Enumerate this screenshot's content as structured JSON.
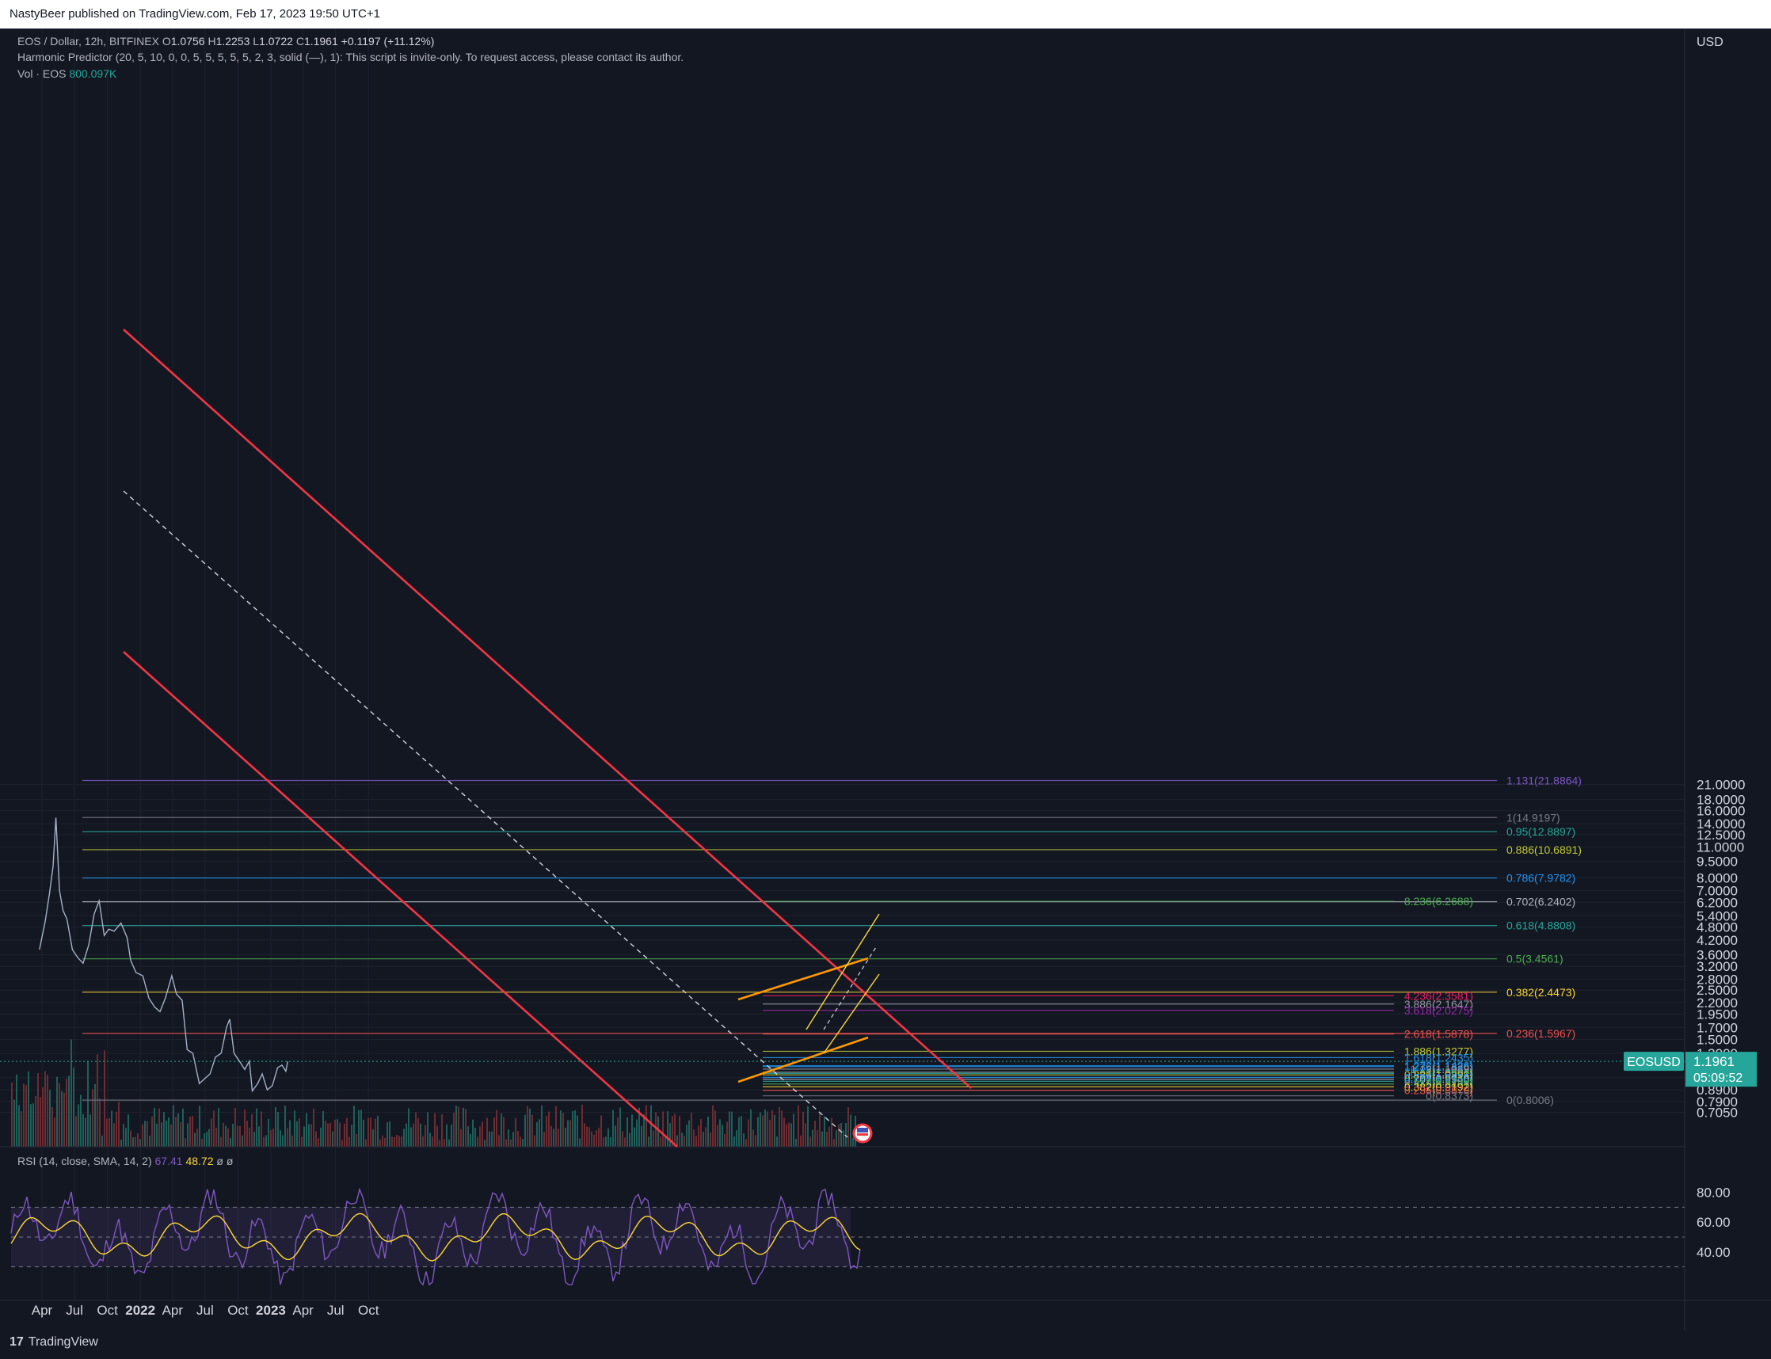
{
  "header": {
    "published": "NastyBeer published on TradingView.com, Feb 17, 2023 19:50 UTC+1"
  },
  "legend": {
    "symbol": "EOS / Dollar, 12h, BITFINEX",
    "o_label": "O",
    "o": "1.0756",
    "h_label": "H",
    "h": "1.2253",
    "l_label": "L",
    "l": "1.0722",
    "c_label": "C",
    "c": "1.1961",
    "change": "+0.1197 (+11.12%)",
    "indicator": "Harmonic Predictor (20, 5, 10, 0, 0, 5, 5, 5, 5, 5, 2, 3, solid (—), 1): This script is invite-only. To request access, please contact its author.",
    "vol_label": "Vol · EOS",
    "vol_value": "800.097K"
  },
  "rsi": {
    "label": "RSI (14, close, SMA, 14, 2)",
    "value1": "67.41",
    "value2": "48.72",
    "extra": "ø  ø"
  },
  "price_tag": {
    "symbol": "EOSUSD",
    "price": "1.1961",
    "countdown": "05:09:52"
  },
  "footer": {
    "brand": "TradingView",
    "logo_glyph": "17"
  },
  "colors": {
    "background": "#131722",
    "up": "#26a69a",
    "down": "#ef5350",
    "channel": "#f23645",
    "orange": "#ff9800",
    "rsi": "#7e57c2"
  },
  "chart_data": {
    "type": "line",
    "title": "",
    "currency": "USD",
    "scale": "log",
    "y_ticks": [
      "21.0000",
      "18.0000",
      "16.0000",
      "14.0000",
      "12.5000",
      "11.0000",
      "9.5000",
      "8.0000",
      "7.0000",
      "6.2000",
      "5.4000",
      "4.8000",
      "4.2000",
      "3.6000",
      "3.2000",
      "2.8000",
      "2.5000",
      "2.2000",
      "1.9500",
      "1.7000",
      "1.5000",
      "1.3000",
      "1.0100",
      "0.8900",
      "0.7900",
      "0.7050"
    ],
    "x_ticks": [
      "Apr",
      "Jul",
      "Oct",
      "2022",
      "Apr",
      "Jul",
      "Oct",
      "2023",
      "Apr",
      "Jul",
      "Oct"
    ],
    "ylim": [
      0.66,
      24.5
    ],
    "price_series": [
      {
        "x": "2021-03-25",
        "y": 3.8
      },
      {
        "x": "2021-04-10",
        "y": 5.1
      },
      {
        "x": "2021-04-22",
        "y": 6.8
      },
      {
        "x": "2021-05-02",
        "y": 9.0
      },
      {
        "x": "2021-05-10",
        "y": 14.9
      },
      {
        "x": "2021-05-20",
        "y": 7.0
      },
      {
        "x": "2021-05-30",
        "y": 5.7
      },
      {
        "x": "2021-06-10",
        "y": 5.2
      },
      {
        "x": "2021-06-25",
        "y": 3.8
      },
      {
        "x": "2021-07-10",
        "y": 3.5
      },
      {
        "x": "2021-07-25",
        "y": 3.3
      },
      {
        "x": "2021-08-10",
        "y": 4.0
      },
      {
        "x": "2021-08-25",
        "y": 5.5
      },
      {
        "x": "2021-09-08",
        "y": 6.3
      },
      {
        "x": "2021-09-22",
        "y": 4.4
      },
      {
        "x": "2021-10-05",
        "y": 4.7
      },
      {
        "x": "2021-10-20",
        "y": 4.6
      },
      {
        "x": "2021-11-08",
        "y": 5.0
      },
      {
        "x": "2021-11-25",
        "y": 4.3
      },
      {
        "x": "2021-12-05",
        "y": 3.4
      },
      {
        "x": "2021-12-20",
        "y": 3.0
      },
      {
        "x": "2022-01-08",
        "y": 2.9
      },
      {
        "x": "2022-01-25",
        "y": 2.3
      },
      {
        "x": "2022-02-10",
        "y": 2.1
      },
      {
        "x": "2022-02-25",
        "y": 2.0
      },
      {
        "x": "2022-03-12",
        "y": 2.3
      },
      {
        "x": "2022-03-30",
        "y": 2.9
      },
      {
        "x": "2022-04-12",
        "y": 2.4
      },
      {
        "x": "2022-04-28",
        "y": 2.25
      },
      {
        "x": "2022-05-12",
        "y": 1.35
      },
      {
        "x": "2022-05-28",
        "y": 1.3
      },
      {
        "x": "2022-06-15",
        "y": 0.95
      },
      {
        "x": "2022-06-30",
        "y": 1.0
      },
      {
        "x": "2022-07-15",
        "y": 1.05
      },
      {
        "x": "2022-07-30",
        "y": 1.25
      },
      {
        "x": "2022-08-15",
        "y": 1.3
      },
      {
        "x": "2022-08-30",
        "y": 1.7
      },
      {
        "x": "2022-09-08",
        "y": 1.85
      },
      {
        "x": "2022-09-20",
        "y": 1.3
      },
      {
        "x": "2022-10-05",
        "y": 1.2
      },
      {
        "x": "2022-10-20",
        "y": 1.1
      },
      {
        "x": "2022-11-02",
        "y": 1.2
      },
      {
        "x": "2022-11-10",
        "y": 0.88
      },
      {
        "x": "2022-11-25",
        "y": 0.95
      },
      {
        "x": "2022-12-08",
        "y": 1.05
      },
      {
        "x": "2022-12-22",
        "y": 0.89
      },
      {
        "x": "2023-01-05",
        "y": 0.93
      },
      {
        "x": "2023-01-20",
        "y": 1.12
      },
      {
        "x": "2023-02-01",
        "y": 1.15
      },
      {
        "x": "2023-02-12",
        "y": 1.08
      },
      {
        "x": "2023-02-17",
        "y": 1.1961
      }
    ],
    "fib_levels": [
      {
        "label": "1.131(21.8864)",
        "y": 21.8864,
        "color": "#7e57c2"
      },
      {
        "label": "1(14.9197)",
        "y": 14.9197,
        "color": "#787b86"
      },
      {
        "label": "0.95(12.8897)",
        "y": 12.8897,
        "color": "#26a69a"
      },
      {
        "label": "0.886(10.6891)",
        "y": 10.6891,
        "color": "#c0ca33"
      },
      {
        "label": "0.786(7.9782)",
        "y": 7.9782,
        "color": "#2196f3"
      },
      {
        "label": "0.702(6.2402)",
        "y": 6.2402,
        "color": "#b2b5be"
      },
      {
        "label": "0.618(4.8808)",
        "y": 4.8808,
        "color": "#26a69a"
      },
      {
        "label": "0.5(3.4561)",
        "y": 3.4561,
        "color": "#4caf50"
      },
      {
        "label": "0.382(2.4473)",
        "y": 2.4473,
        "color": "#fdd835"
      },
      {
        "label": "0.236(1.5967)",
        "y": 1.5967,
        "color": "#ef5350"
      },
      {
        "label": "0(0.8006)",
        "y": 0.8006,
        "color": "#787b86"
      }
    ],
    "projection_levels": [
      {
        "label": "8.236(6.2688)",
        "y": 6.2688,
        "color": "#4caf50"
      },
      {
        "label": "4.236(2.3581)",
        "y": 2.3581,
        "color": "#e91e63"
      },
      {
        "label": "3.886(2.1647)",
        "y": 2.1647,
        "color": "#9598a1"
      },
      {
        "label": "3.618(2.0275)",
        "y": 2.0275,
        "color": "#9c27b0"
      },
      {
        "label": "2.618(1.5878)",
        "y": 1.5878,
        "color": "#ef5350"
      },
      {
        "label": "1.886(1.3277)",
        "y": 1.3277,
        "color": "#c0ca33"
      },
      {
        "label": "1.618(1.2435)",
        "y": 1.2435,
        "color": "#2196f3"
      },
      {
        "label": "1.272(1.1426)",
        "y": 1.1426,
        "color": "#2196f3"
      },
      {
        "label": "1.236(1.1326)",
        "y": 1.1326,
        "color": "#2196f3"
      },
      {
        "label": "1.13(1.1039)",
        "y": 1.1039,
        "color": "#9598a1"
      },
      {
        "label": "1(1.0691)",
        "y": 1.0691,
        "color": "#9598a1"
      },
      {
        "label": "0.95(1.0561)",
        "y": 1.0561,
        "color": "#26a69a"
      },
      {
        "label": "0.886(1.0398)",
        "y": 1.0398,
        "color": "#c0ca33"
      },
      {
        "label": "0.786(1.0135)",
        "y": 1.0135,
        "color": "#2196f3"
      },
      {
        "label": "0.707(0.9940)",
        "y": 0.994,
        "color": "#b2b5be"
      },
      {
        "label": "0.618(0.9730)",
        "y": 0.973,
        "color": "#26a69a"
      },
      {
        "label": "0.5(0.9461)",
        "y": 0.9461,
        "color": "#4caf50"
      },
      {
        "label": "0.382(0.9192)",
        "y": 0.9192,
        "color": "#fdd835"
      },
      {
        "label": "0.236(0.8870)",
        "y": 0.887,
        "color": "#ef5350"
      },
      {
        "label": "0(0.8373)",
        "y": 0.8373,
        "color": "#787b86"
      }
    ],
    "rsi_ticks": [
      "80.00",
      "60.00",
      "40.00"
    ],
    "rsi_range": [
      0,
      100
    ]
  }
}
